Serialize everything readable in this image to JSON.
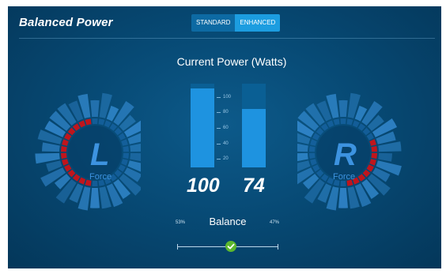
{
  "header": {
    "title": "Balanced Power",
    "modes": [
      {
        "label": "STANDARD",
        "active": false
      },
      {
        "label": "ENHANCED",
        "active": true
      }
    ]
  },
  "power": {
    "title": "Current Power (Watts)",
    "left_value": "100",
    "right_value": "74",
    "left_fill": 1.0,
    "right_fill": 0.74,
    "scale_ticks": [
      "100",
      "80",
      "60",
      "40",
      "20"
    ]
  },
  "dials": {
    "left": {
      "letter": "L",
      "label": "Force"
    },
    "right": {
      "letter": "R",
      "label": "Force"
    }
  },
  "balance": {
    "title": "Balance",
    "left_percent": "53%",
    "right_percent": "47%",
    "position": 0.53
  },
  "colors": {
    "accent": "#1e93e0",
    "force_red": "#c0151c",
    "thumb_green": "#5cb82e",
    "letter_blue": "#3d93e0"
  },
  "icons": {
    "balance_thumb": "check-circle-icon"
  }
}
